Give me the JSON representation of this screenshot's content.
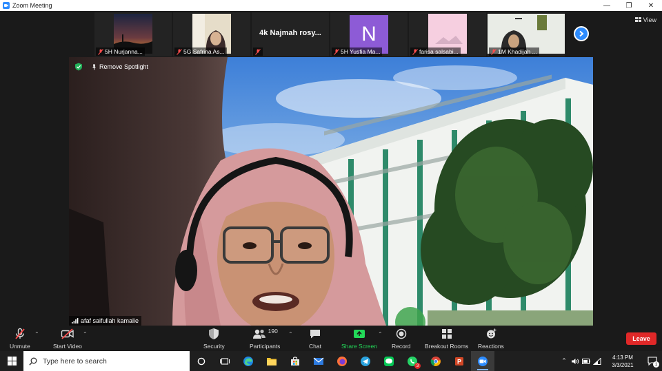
{
  "window": {
    "title": "Zoom Meeting"
  },
  "thumbnails": [
    {
      "name": "5H Nurjanna...",
      "type": "video"
    },
    {
      "name": "5G Safrina As...",
      "type": "video"
    },
    {
      "name": "",
      "type": "text",
      "display": "4k Najmah rosy..."
    },
    {
      "name": "5H Yusfia Ma...",
      "type": "avatar",
      "letter": "N",
      "color": "#8d5bd6"
    },
    {
      "name": "farisa salsabi...",
      "type": "video"
    },
    {
      "name": "1M Khadijah ...",
      "type": "video"
    }
  ],
  "view_label": "View",
  "spotlight": {
    "remove_label": "Remove Spotlight"
  },
  "main_speaker": {
    "name": "afaf saifullah kamalie"
  },
  "toolbar": {
    "unmute": "Unmute",
    "start_video": "Start Video",
    "security": "Security",
    "participants": "Participants",
    "participants_count": "190",
    "chat": "Chat",
    "share_screen": "Share Screen",
    "record": "Record",
    "breakout_rooms": "Breakout Rooms",
    "reactions": "Reactions",
    "leave": "Leave"
  },
  "colors": {
    "accent": "#2d8cff",
    "share_green": "#23d959",
    "leave_red": "#e02828"
  },
  "taskbar": {
    "search_placeholder": "Type here to search",
    "time": "4:13 PM",
    "date": "3/3/2021",
    "whatsapp_badge": "3",
    "notification_count": "1"
  }
}
